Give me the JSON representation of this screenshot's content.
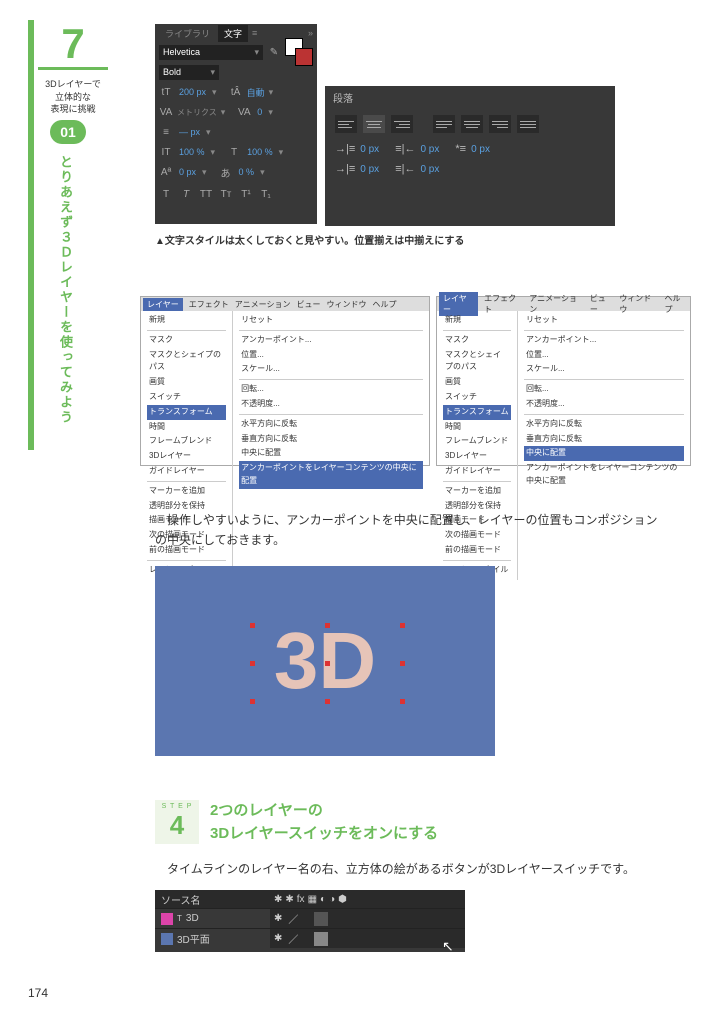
{
  "chapter": {
    "num": "7",
    "title": "3Dレイヤーで\n立体的な\n表現に挑戦",
    "badge": "01",
    "vtext": "とりあえず３Ｄレイヤーを使ってみよう"
  },
  "charPanel": {
    "tabs": {
      "lib": "ライブラリ",
      "char": "文字"
    },
    "font": "Helvetica",
    "weight": "Bold",
    "size": "200 px",
    "leading": "自動",
    "metrics": "メトリクス",
    "tracking": "0",
    "vscale": "100 %",
    "hscale": "100 %",
    "baseline": "0 px",
    "tsume": "0 %",
    "stroke": "— px"
  },
  "paraPanel": {
    "title": "段落",
    "indent": "0 px"
  },
  "caption": "▲文字スタイルは太くしておくと見やすい。位置揃えは中揃えにする",
  "menu": {
    "bar": [
      "レイヤー",
      "エフェクト",
      "アニメーション",
      "ビュー",
      "ウィンドウ",
      "ヘルプ"
    ],
    "left": {
      "items1": [
        "新規",
        "マスク",
        "マスクとシェイプのパス",
        "画質",
        "スイッチ"
      ],
      "hl": "トランスフォーム",
      "items2": [
        "時間",
        "フレームブレンド",
        "3Dレイヤー",
        "ガイドレイヤー",
        "マーカーを追加",
        "透明部分を保持",
        "描画モード",
        "次の描画モード",
        "前の描画モード",
        "レイヤースタイル"
      ],
      "sub": [
        "リセット",
        "アンカーポイント...",
        "位置...",
        "スケール...",
        "回転...",
        "不透明度...",
        "水平方向に反転",
        "垂直方向に反転",
        "中央に配置"
      ],
      "subhl": "アンカーポイントをレイヤーコンテンツの中央に配置"
    },
    "right": {
      "subhl": "中央に配置",
      "subafter": "アンカーポイントをレイヤーコンテンツの中央に配置"
    }
  },
  "body1": "　操作しやすいように、アンカーポイントを中央に配置し、レイヤーの位置もコンポジションの中央にしておきます。",
  "preview": "3D",
  "step": {
    "label": "S T E P",
    "num": "4",
    "title1": "2つのレイヤーの",
    "title2": "3Dレイヤースイッチをオンにする",
    "desc": "　タイムラインのレイヤー名の右、立方体の絵があるボタンが3Dレイヤースイッチです。"
  },
  "timeline": {
    "header": "ソース名",
    "layer1": "3D",
    "layer2": "3D平面"
  },
  "pageNum": "174"
}
